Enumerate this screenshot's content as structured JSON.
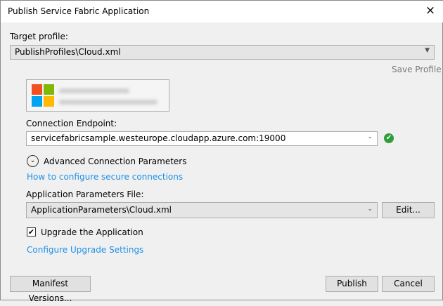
{
  "window": {
    "title": "Publish Service Fabric Application",
    "close_icon": "×"
  },
  "target_profile": {
    "label": "Target profile:",
    "value": "PublishProfiles\\Cloud.xml",
    "save_label": "Save Profile"
  },
  "account": {
    "logo": "microsoft-logo",
    "colors": [
      "#f25022",
      "#7fba00",
      "#00a4ef",
      "#ffb900"
    ]
  },
  "connection": {
    "label": "Connection Endpoint:",
    "value": "servicefabricsample.westeurope.cloudapp.azure.com:19000",
    "status_icon": "✔"
  },
  "advanced": {
    "label": "Advanced Connection Parameters",
    "icon": "⌄",
    "link": "How to configure secure connections"
  },
  "app_params": {
    "label": "Application Parameters File:",
    "value": "ApplicationParameters\\Cloud.xml",
    "edit_label": "Edit..."
  },
  "upgrade": {
    "label": "Upgrade the Application",
    "checked": "✔",
    "link": "Configure Upgrade Settings"
  },
  "footer": {
    "manifest_label": "Manifest Versions...",
    "publish_label": "Publish",
    "cancel_label": "Cancel"
  }
}
